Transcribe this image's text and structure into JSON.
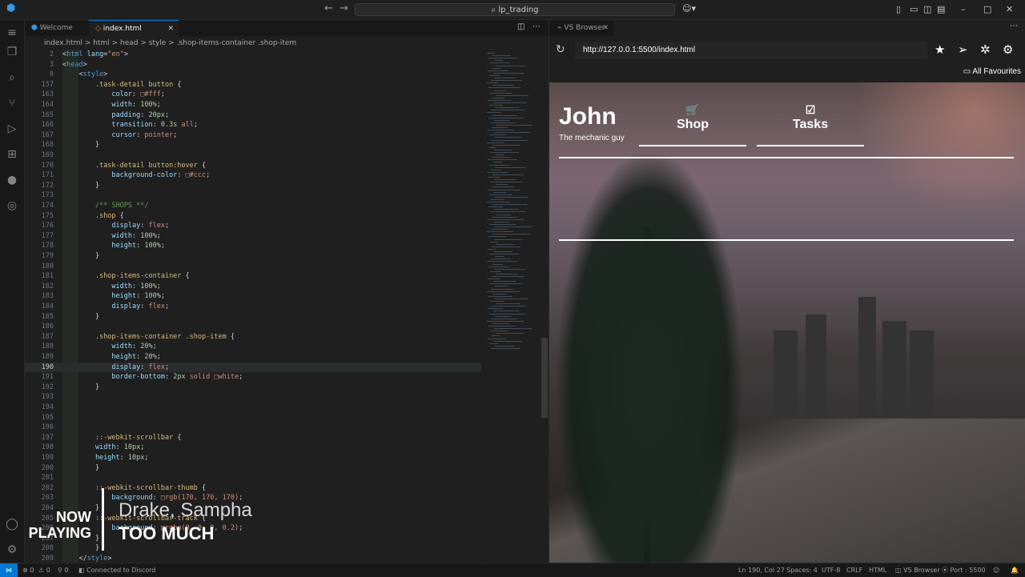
{
  "window": {
    "search": "lp_trading"
  },
  "tabs": [
    {
      "label": "Welcome"
    },
    {
      "label": "index.html"
    }
  ],
  "breadcrumb": {
    "text": "index.html > html > head > style > .shop-items-container .shop-item"
  },
  "editor": {
    "lines": [
      {
        "n": "2",
        "html": "<span class=\"punc\">&lt;</span><span class=\"tag\">html</span> <span class=\"attr\">lang</span><span class=\"punc\">=</span><span class=\"str\">\"en\"</span><span class=\"punc\">&gt;</span>"
      },
      {
        "n": "3",
        "html": "<span class=\"punc\">&lt;</span><span class=\"tag\">head</span><span class=\"punc\">&gt;</span>"
      },
      {
        "n": "8",
        "html": "    <span class=\"punc\">&lt;</span><span class=\"tag\">style</span><span class=\"punc\">&gt;</span>"
      },
      {
        "n": "157",
        "html": "        <span class=\"sel\">.task-detail button</span> <span class=\"punc\">{</span>"
      },
      {
        "n": "163",
        "html": "            <span class=\"prop\">color</span>: <span class=\"val\">□#fff</span>;"
      },
      {
        "n": "164",
        "html": "            <span class=\"prop\">width</span>: <span class=\"num\">100%</span>;"
      },
      {
        "n": "165",
        "html": "            <span class=\"prop\">padding</span>: <span class=\"num\">20px</span>;"
      },
      {
        "n": "166",
        "html": "            <span class=\"prop\">transition</span>: <span class=\"num\">0.3s</span> <span class=\"val\">all</span>;"
      },
      {
        "n": "167",
        "html": "            <span class=\"prop\">cursor</span>: <span class=\"val\">pointer</span>;"
      },
      {
        "n": "168",
        "html": "        <span class=\"punc\">}</span>"
      },
      {
        "n": "169",
        "html": ""
      },
      {
        "n": "170",
        "html": "        <span class=\"sel\">.task-detail button:hover</span> <span class=\"punc\">{</span>"
      },
      {
        "n": "171",
        "html": "            <span class=\"prop\">background-color</span>: <span class=\"val\">□#ccc</span>;"
      },
      {
        "n": "172",
        "html": "        <span class=\"punc\">}</span>"
      },
      {
        "n": "173",
        "html": ""
      },
      {
        "n": "174",
        "html": "        <span class=\"cmt\">/** SHOPS **/</span>"
      },
      {
        "n": "175",
        "html": "        <span class=\"sel\">.shop</span> <span class=\"punc\">{</span>"
      },
      {
        "n": "176",
        "html": "            <span class=\"prop\">display</span>: <span class=\"val\">flex</span>;"
      },
      {
        "n": "177",
        "html": "            <span class=\"prop\">width</span>: <span class=\"num\">100%</span>;"
      },
      {
        "n": "178",
        "html": "            <span class=\"prop\">height</span>: <span class=\"num\">100%</span>;"
      },
      {
        "n": "179",
        "html": "        <span class=\"punc\">}</span>"
      },
      {
        "n": "180",
        "html": ""
      },
      {
        "n": "181",
        "html": "        <span class=\"sel\">.shop-items-container</span> <span class=\"punc\">{</span>"
      },
      {
        "n": "182",
        "html": "            <span class=\"prop\">width</span>: <span class=\"num\">100%</span>;"
      },
      {
        "n": "183",
        "html": "            <span class=\"prop\">height</span>: <span class=\"num\">100%</span>;"
      },
      {
        "n": "184",
        "html": "            <span class=\"prop\">display</span>: <span class=\"val\">flex</span>;"
      },
      {
        "n": "185",
        "html": "        <span class=\"punc\">}</span>"
      },
      {
        "n": "186",
        "html": ""
      },
      {
        "n": "187",
        "html": "        <span class=\"sel\">.shop-items-container .shop-item</span> <span class=\"punc\">{</span>"
      },
      {
        "n": "188",
        "html": "            <span class=\"prop\">width</span>: <span class=\"num\">20%</span>;"
      },
      {
        "n": "189",
        "html": "            <span class=\"prop\">height</span>: <span class=\"num\">20%</span>;"
      },
      {
        "n": "190",
        "html": "            <span class=\"prop\">display</span>: <span class=\"val\">flex</span>;",
        "current": true
      },
      {
        "n": "191",
        "html": "            <span class=\"prop\">border-bottom</span>: <span class=\"num\">2px</span> <span class=\"val\">solid</span> <span class=\"val\">□white</span>;"
      },
      {
        "n": "192",
        "html": "        <span class=\"punc\">}</span>"
      },
      {
        "n": "193",
        "html": ""
      },
      {
        "n": "194",
        "html": ""
      },
      {
        "n": "195",
        "html": ""
      },
      {
        "n": "196",
        "html": ""
      },
      {
        "n": "197",
        "html": "        <span class=\"sel\">::-webkit-scrollbar</span> <span class=\"punc\">{</span>"
      },
      {
        "n": "198",
        "html": "        <span class=\"prop\">width</span>: <span class=\"num\">10px</span>;"
      },
      {
        "n": "199",
        "html": "        <span class=\"prop\">height</span>: <span class=\"num\">10px</span>;"
      },
      {
        "n": "200",
        "html": "        <span class=\"punc\">}</span>"
      },
      {
        "n": "201",
        "html": ""
      },
      {
        "n": "202",
        "html": "        <span class=\"sel\">::-webkit-scrollbar-thumb</span> <span class=\"punc\">{</span>"
      },
      {
        "n": "203",
        "html": "            <span class=\"prop\">background</span>: <span class=\"val\">□rgb(170, 170, 170)</span>;"
      },
      {
        "n": "204",
        "html": "        <span class=\"punc\">}</span>"
      },
      {
        "n": "205",
        "html": "        <span class=\"sel\">::-webkit-scrollbar-track</span> <span class=\"punc\">{</span>"
      },
      {
        "n": "206",
        "html": "            <span class=\"prop\">background</span>: <span class=\"val\">□rgba(0, 0, 0, 0.2)</span>;"
      },
      {
        "n": "207",
        "html": "        <span class=\"punc\">}</span>"
      },
      {
        "n": "208",
        "html": "        <span class=\"punc\">}</span>"
      },
      {
        "n": "209",
        "html": "    <span class=\"punc\">&lt;/</span><span class=\"tag\">style</span><span class=\"punc\">&gt;</span>"
      }
    ]
  },
  "overlay": {
    "now_playing": "NOW PLAYING",
    "artist": "Drake, Sampha",
    "title": "TOO MUCH"
  },
  "browser": {
    "tab_label": "VS Browser",
    "url": "http://127.0.0.1:5500/index.html",
    "favourites": "All Favourites",
    "site": {
      "brand": "John",
      "tagline": "The mechanic guy",
      "nav": [
        {
          "label": "Shop",
          "icon": "cart-icon"
        },
        {
          "label": "Tasks",
          "icon": "list-check-icon"
        }
      ]
    }
  },
  "statusbar": {
    "errors": "0",
    "warnings": "0",
    "ports": "0",
    "discord": "Connected to Discord",
    "position": "Ln 190, Col 27",
    "spaces": "Spaces: 4",
    "encoding": "UTF-8",
    "eol": "CRLF",
    "language": "HTML",
    "vsbrowser": "VS Browser",
    "port": "Port : 5500"
  },
  "colors": {
    "accent": "#0078d4",
    "editor_bg": "#1f1f1f"
  }
}
